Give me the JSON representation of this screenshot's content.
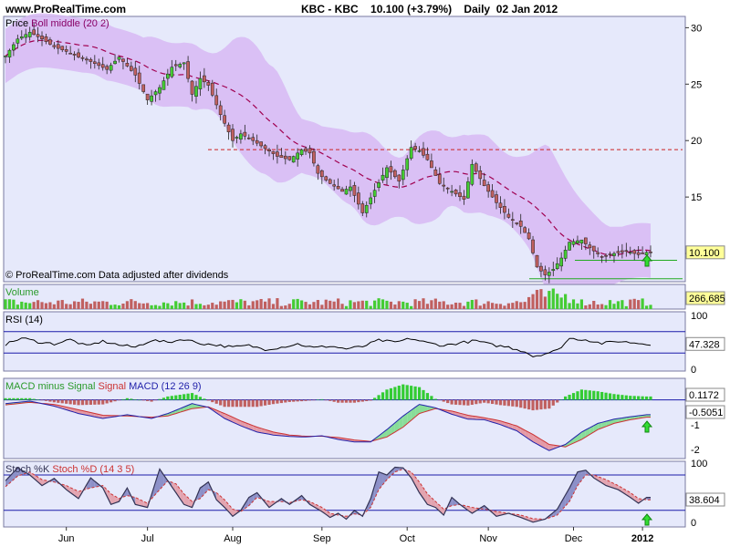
{
  "header": {
    "site": "www.ProRealTime.com",
    "symbol": "KBC - KBC",
    "price_change": "10.100 (+3.79%)",
    "period": "Daily  02 Jan 2012"
  },
  "colors": {
    "panel_bg": "#e6e9fb",
    "band": "#d7b8f3",
    "up": "#44cc33",
    "down": "#c06060",
    "boll_mid": "#a00050",
    "support": "#22aa22",
    "resistance": "#cc2222",
    "rsi_line": "#000000",
    "macd_line": "#2222aa",
    "signal_line": "#cc3333",
    "hist": "#33cc33",
    "stoch_k": "#333355",
    "stoch_d": "#cc3333",
    "last_value_bg": "#ffff99",
    "guide": "#1a1aaa"
  },
  "x_axis": {
    "labels": [
      "Jun",
      "Jul",
      "Aug",
      "Sep",
      "Oct",
      "Nov",
      "Dec",
      "2012"
    ]
  },
  "chart_data": [
    {
      "type": "candlestick",
      "title_prefix": "Price",
      "indicator": "Boll middle (20 2)",
      "footnote": "© ProRealTime.com  Data adjusted after dividends",
      "y_ticks": [
        10,
        15,
        20,
        25,
        30
      ],
      "ylim": [
        7.5,
        31
      ],
      "last_value": "10.100",
      "resistance_level": 19.2,
      "support_levels": [
        7.6,
        9.4
      ],
      "signal_arrow": "up",
      "trend_points": [
        [
          0,
          27.5
        ],
        [
          3,
          29
        ],
        [
          6,
          29.6
        ],
        [
          9,
          29
        ],
        [
          12,
          28.3
        ],
        [
          15,
          27.9
        ],
        [
          18,
          27.4
        ],
        [
          21,
          27
        ],
        [
          25,
          26.3
        ],
        [
          28,
          27.4
        ],
        [
          32,
          25.8
        ],
        [
          35,
          23.6
        ],
        [
          38,
          24.7
        ],
        [
          41,
          26.5
        ],
        [
          44,
          26.9
        ],
        [
          46,
          24.1
        ],
        [
          48,
          25.5
        ],
        [
          50,
          24.9
        ],
        [
          53,
          22.3
        ],
        [
          56,
          20
        ],
        [
          58,
          20.6
        ],
        [
          61,
          20
        ],
        [
          64,
          19.3
        ],
        [
          67,
          18.6
        ],
        [
          70,
          18.3
        ],
        [
          73,
          19.2
        ],
        [
          75,
          18.9
        ],
        [
          77,
          17.1
        ],
        [
          80,
          16.2
        ],
        [
          83,
          15.5
        ],
        [
          85,
          15.9
        ],
        [
          88,
          13.6
        ],
        [
          91,
          15.6
        ],
        [
          94,
          17.6
        ],
        [
          97,
          16.4
        ],
        [
          100,
          19.4
        ],
        [
          102,
          19.1
        ],
        [
          104,
          18.3
        ],
        [
          107,
          16.2
        ],
        [
          110,
          15.5
        ],
        [
          113,
          14.8
        ],
        [
          115,
          17.9
        ],
        [
          118,
          16
        ],
        [
          121,
          14.5
        ],
        [
          124,
          13.2
        ],
        [
          127,
          12.4
        ],
        [
          129,
          11.3
        ],
        [
          131,
          8.8
        ],
        [
          133,
          8.1
        ],
        [
          135,
          8.6
        ],
        [
          137,
          9.6
        ],
        [
          139,
          11
        ],
        [
          142,
          11.2
        ],
        [
          144,
          10.5
        ],
        [
          147,
          9.7
        ],
        [
          150,
          10
        ],
        [
          153,
          10.2
        ],
        [
          156,
          9.9
        ],
        [
          158,
          10.1
        ]
      ]
    },
    {
      "type": "bar",
      "title": "Volume",
      "last_value": "266,685"
    },
    {
      "type": "line",
      "title": "RSI (14)",
      "y_ticks": [
        0,
        100
      ],
      "ylim": [
        0,
        100
      ],
      "guides": [
        30,
        70
      ],
      "last_value": "47.328",
      "trend_points": [
        [
          0,
          46
        ],
        [
          4,
          58
        ],
        [
          8,
          51
        ],
        [
          12,
          47
        ],
        [
          16,
          55
        ],
        [
          20,
          43
        ],
        [
          24,
          52
        ],
        [
          28,
          45
        ],
        [
          32,
          41
        ],
        [
          36,
          54
        ],
        [
          40,
          50
        ],
        [
          44,
          56
        ],
        [
          48,
          48
        ],
        [
          52,
          45
        ],
        [
          56,
          41
        ],
        [
          60,
          44
        ],
        [
          64,
          37
        ],
        [
          68,
          41
        ],
        [
          72,
          47
        ],
        [
          76,
          40
        ],
        [
          80,
          43
        ],
        [
          84,
          38
        ],
        [
          88,
          42
        ],
        [
          92,
          54
        ],
        [
          96,
          50
        ],
        [
          100,
          57
        ],
        [
          104,
          49
        ],
        [
          108,
          44
        ],
        [
          112,
          49
        ],
        [
          116,
          53
        ],
        [
          120,
          45
        ],
        [
          124,
          41
        ],
        [
          128,
          33
        ],
        [
          130,
          24
        ],
        [
          133,
          29
        ],
        [
          136,
          35
        ],
        [
          139,
          57
        ],
        [
          143,
          55
        ],
        [
          147,
          48
        ],
        [
          151,
          52
        ],
        [
          155,
          49
        ],
        [
          158,
          47
        ]
      ]
    },
    {
      "type": "line",
      "title_segments": [
        "MACD minus Signal",
        "Signal",
        "MACD (12 26 9)"
      ],
      "y_ticks": [
        -2,
        -1
      ],
      "ylim": [
        -2.3,
        0.8
      ],
      "last_values": [
        "0.1172",
        "-0.5051"
      ],
      "signal_arrow": "up",
      "macd_points": [
        [
          0,
          -0.15
        ],
        [
          6,
          -0.05
        ],
        [
          12,
          -0.25
        ],
        [
          18,
          -0.55
        ],
        [
          24,
          -0.75
        ],
        [
          30,
          -0.6
        ],
        [
          36,
          -0.75
        ],
        [
          40,
          -0.55
        ],
        [
          46,
          -0.15
        ],
        [
          50,
          -0.3
        ],
        [
          54,
          -0.75
        ],
        [
          58,
          -1.05
        ],
        [
          62,
          -1.3
        ],
        [
          66,
          -1.42
        ],
        [
          70,
          -1.48
        ],
        [
          74,
          -1.5
        ],
        [
          78,
          -1.45
        ],
        [
          82,
          -1.6
        ],
        [
          86,
          -1.7
        ],
        [
          90,
          -1.7
        ],
        [
          94,
          -1.2
        ],
        [
          98,
          -0.65
        ],
        [
          102,
          -0.18
        ],
        [
          106,
          -0.32
        ],
        [
          110,
          -0.58
        ],
        [
          114,
          -0.78
        ],
        [
          118,
          -0.8
        ],
        [
          122,
          -1
        ],
        [
          126,
          -1.25
        ],
        [
          130,
          -1.7
        ],
        [
          134,
          -2.05
        ],
        [
          138,
          -1.8
        ],
        [
          142,
          -1.3
        ],
        [
          146,
          -0.95
        ],
        [
          150,
          -0.78
        ],
        [
          154,
          -0.68
        ],
        [
          158,
          -0.6
        ]
      ],
      "signal_points": [
        [
          0,
          -0.2
        ],
        [
          6,
          -0.1
        ],
        [
          12,
          -0.18
        ],
        [
          18,
          -0.4
        ],
        [
          24,
          -0.62
        ],
        [
          30,
          -0.65
        ],
        [
          36,
          -0.7
        ],
        [
          40,
          -0.65
        ],
        [
          46,
          -0.35
        ],
        [
          50,
          -0.28
        ],
        [
          54,
          -0.55
        ],
        [
          58,
          -0.85
        ],
        [
          62,
          -1.1
        ],
        [
          66,
          -1.3
        ],
        [
          70,
          -1.42
        ],
        [
          74,
          -1.47
        ],
        [
          78,
          -1.47
        ],
        [
          82,
          -1.52
        ],
        [
          86,
          -1.62
        ],
        [
          90,
          -1.68
        ],
        [
          94,
          -1.5
        ],
        [
          98,
          -1.1
        ],
        [
          102,
          -0.55
        ],
        [
          106,
          -0.35
        ],
        [
          110,
          -0.45
        ],
        [
          114,
          -0.62
        ],
        [
          118,
          -0.72
        ],
        [
          122,
          -0.85
        ],
        [
          126,
          -1.05
        ],
        [
          130,
          -1.4
        ],
        [
          134,
          -1.8
        ],
        [
          138,
          -1.9
        ],
        [
          142,
          -1.6
        ],
        [
          146,
          -1.2
        ],
        [
          150,
          -0.95
        ],
        [
          154,
          -0.8
        ],
        [
          158,
          -0.7
        ]
      ]
    },
    {
      "type": "line",
      "title_segments": [
        "Stoch %K",
        "Stoch %D (14 3 5)"
      ],
      "y_ticks": [
        0,
        100
      ],
      "ylim": [
        -5,
        100
      ],
      "guides": [
        20,
        80
      ],
      "last_value": "38.604",
      "signal_arrow": "up",
      "k_points": [
        [
          0,
          70
        ],
        [
          3,
          92
        ],
        [
          6,
          80
        ],
        [
          9,
          62
        ],
        [
          12,
          74
        ],
        [
          15,
          55
        ],
        [
          18,
          40
        ],
        [
          21,
          75
        ],
        [
          24,
          58
        ],
        [
          26,
          30
        ],
        [
          28,
          35
        ],
        [
          30,
          58
        ],
        [
          32,
          30
        ],
        [
          35,
          25
        ],
        [
          38,
          90
        ],
        [
          40,
          70
        ],
        [
          42,
          50
        ],
        [
          44,
          30
        ],
        [
          46,
          25
        ],
        [
          48,
          58
        ],
        [
          50,
          68
        ],
        [
          52,
          38
        ],
        [
          54,
          25
        ],
        [
          56,
          10
        ],
        [
          58,
          20
        ],
        [
          60,
          42
        ],
        [
          62,
          50
        ],
        [
          65,
          25
        ],
        [
          68,
          40
        ],
        [
          70,
          30
        ],
        [
          73,
          45
        ],
        [
          75,
          30
        ],
        [
          78,
          18
        ],
        [
          80,
          8
        ],
        [
          82,
          15
        ],
        [
          84,
          5
        ],
        [
          86,
          20
        ],
        [
          88,
          10
        ],
        [
          90,
          40
        ],
        [
          92,
          85
        ],
        [
          94,
          80
        ],
        [
          96,
          93
        ],
        [
          98,
          92
        ],
        [
          100,
          75
        ],
        [
          102,
          50
        ],
        [
          104,
          30
        ],
        [
          106,
          25
        ],
        [
          108,
          12
        ],
        [
          110,
          42
        ],
        [
          112,
          30
        ],
        [
          115,
          15
        ],
        [
          118,
          28
        ],
        [
          121,
          10
        ],
        [
          124,
          15
        ],
        [
          127,
          8
        ],
        [
          130,
          0
        ],
        [
          133,
          5
        ],
        [
          136,
          22
        ],
        [
          139,
          58
        ],
        [
          141,
          85
        ],
        [
          143,
          88
        ],
        [
          145,
          75
        ],
        [
          148,
          62
        ],
        [
          151,
          55
        ],
        [
          154,
          42
        ],
        [
          156,
          32
        ],
        [
          158,
          42
        ]
      ],
      "d_points": [
        [
          0,
          60
        ],
        [
          3,
          78
        ],
        [
          6,
          85
        ],
        [
          9,
          72
        ],
        [
          12,
          68
        ],
        [
          15,
          62
        ],
        [
          18,
          52
        ],
        [
          21,
          58
        ],
        [
          24,
          62
        ],
        [
          26,
          48
        ],
        [
          28,
          40
        ],
        [
          30,
          45
        ],
        [
          32,
          42
        ],
        [
          35,
          32
        ],
        [
          38,
          55
        ],
        [
          40,
          70
        ],
        [
          42,
          65
        ],
        [
          44,
          48
        ],
        [
          46,
          35
        ],
        [
          48,
          40
        ],
        [
          50,
          55
        ],
        [
          52,
          50
        ],
        [
          54,
          38
        ],
        [
          56,
          22
        ],
        [
          58,
          18
        ],
        [
          60,
          28
        ],
        [
          62,
          42
        ],
        [
          65,
          35
        ],
        [
          68,
          35
        ],
        [
          70,
          33
        ],
        [
          73,
          38
        ],
        [
          75,
          35
        ],
        [
          78,
          25
        ],
        [
          80,
          15
        ],
        [
          82,
          12
        ],
        [
          84,
          10
        ],
        [
          86,
          14
        ],
        [
          88,
          12
        ],
        [
          90,
          25
        ],
        [
          92,
          55
        ],
        [
          94,
          72
        ],
        [
          96,
          85
        ],
        [
          98,
          90
        ],
        [
          100,
          85
        ],
        [
          102,
          68
        ],
        [
          104,
          48
        ],
        [
          106,
          35
        ],
        [
          108,
          22
        ],
        [
          110,
          28
        ],
        [
          112,
          30
        ],
        [
          115,
          25
        ],
        [
          118,
          22
        ],
        [
          121,
          18
        ],
        [
          124,
          15
        ],
        [
          127,
          12
        ],
        [
          130,
          6
        ],
        [
          133,
          5
        ],
        [
          136,
          12
        ],
        [
          139,
          35
        ],
        [
          141,
          62
        ],
        [
          143,
          80
        ],
        [
          145,
          80
        ],
        [
          148,
          72
        ],
        [
          151,
          62
        ],
        [
          154,
          50
        ],
        [
          156,
          40
        ],
        [
          158,
          38
        ]
      ]
    }
  ]
}
